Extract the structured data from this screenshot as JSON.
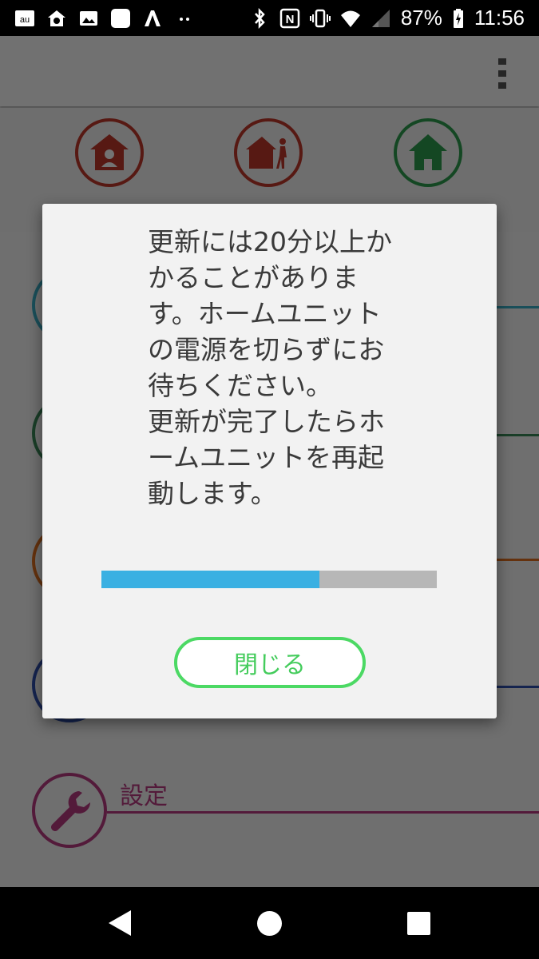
{
  "status_bar": {
    "left_icons": [
      "au-icon",
      "home-share-icon",
      "image-icon",
      "app-icon",
      "a-logo-icon",
      "more-dots-icon"
    ],
    "right_icons": [
      "bluetooth-icon",
      "nfc-icon",
      "vibrate-icon",
      "wifi-icon",
      "signal-icon"
    ],
    "battery_percent": "87%",
    "time": "11:56"
  },
  "app_bar": {
    "menu_icon": "overflow-menu-icon"
  },
  "background": {
    "top_icons": [
      {
        "icon": "person-home-icon",
        "color": "#c0392b"
      },
      {
        "icon": "leaving-home-icon",
        "color": "#c0392b"
      },
      {
        "icon": "home-icon",
        "color": "#2e9e4f"
      }
    ],
    "list_rows": [
      {
        "color": "#3ab0c8"
      },
      {
        "color": "#3a8a5a"
      },
      {
        "color": "#e07020"
      },
      {
        "color": "#3050b0"
      },
      {
        "color": "#b83a80",
        "label": "設定",
        "icon": "wrench-icon"
      }
    ]
  },
  "dialog": {
    "message": "更新には20分以上かかることがあります。ホームユニットの電源を切らずにお待ちください。\n更新が完了したらホームユニットを再起動します。",
    "progress_fraction": 0.65,
    "close_button": "閉じる"
  },
  "nav_bar": {
    "back_icon": "back-icon",
    "home_icon": "home-circle-icon",
    "recent_icon": "recent-apps-icon"
  },
  "colors": {
    "accent_green": "#4cd964",
    "progress_blue": "#3ab0e2",
    "progress_track": "#b7b7b7"
  }
}
